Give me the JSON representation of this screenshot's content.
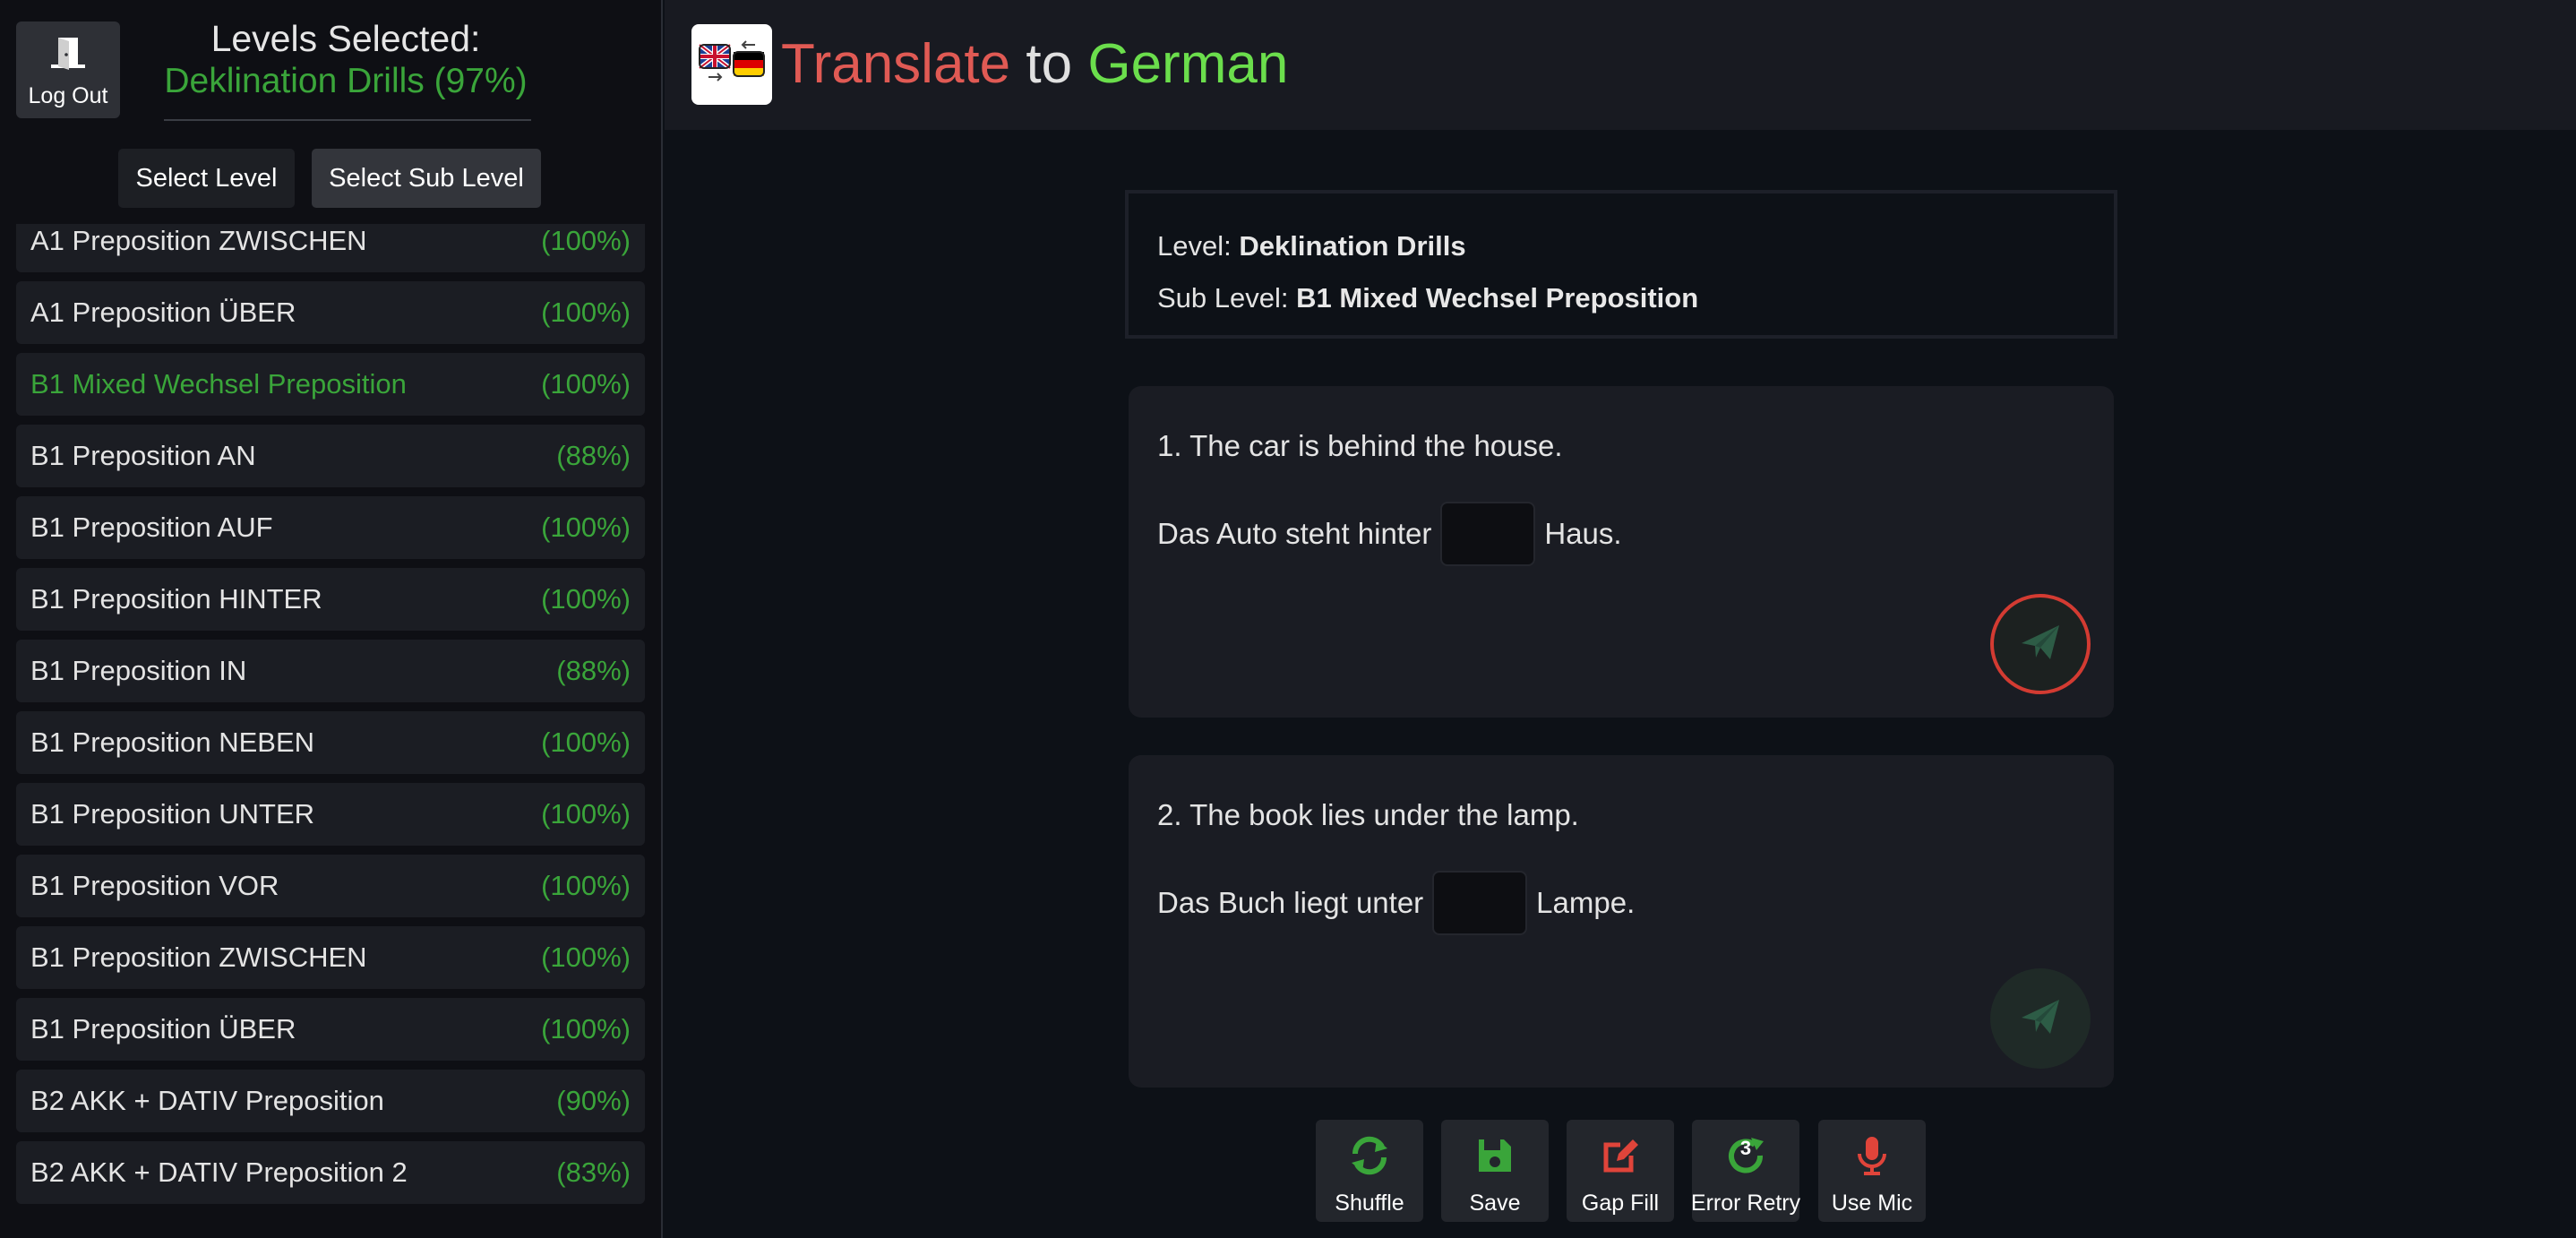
{
  "sidebar": {
    "logout_label": "Log Out",
    "levels_title": "Levels Selected:",
    "levels_value": "Deklination Drills (97%)",
    "select_level_label": "Select Level",
    "select_sub_level_label": "Select Sub Level",
    "items": [
      {
        "label": "A1 Preposition ZWISCHEN",
        "pct": "(100%)",
        "active": false
      },
      {
        "label": "A1 Preposition ÜBER",
        "pct": "(100%)",
        "active": false
      },
      {
        "label": "B1 Mixed Wechsel Preposition",
        "pct": "(100%)",
        "active": true
      },
      {
        "label": "B1 Preposition AN",
        "pct": "(88%)",
        "active": false
      },
      {
        "label": "B1 Preposition AUF",
        "pct": "(100%)",
        "active": false
      },
      {
        "label": "B1 Preposition HINTER",
        "pct": "(100%)",
        "active": false
      },
      {
        "label": "B1 Preposition IN",
        "pct": "(88%)",
        "active": false
      },
      {
        "label": "B1 Preposition NEBEN",
        "pct": "(100%)",
        "active": false
      },
      {
        "label": "B1 Preposition UNTER",
        "pct": "(100%)",
        "active": false
      },
      {
        "label": "B1 Preposition VOR",
        "pct": "(100%)",
        "active": false
      },
      {
        "label": "B1 Preposition ZWISCHEN",
        "pct": "(100%)",
        "active": false
      },
      {
        "label": "B1 Preposition ÜBER",
        "pct": "(100%)",
        "active": false
      },
      {
        "label": "B2 AKK + DATIV Preposition",
        "pct": "(90%)",
        "active": false
      },
      {
        "label": "B2 AKK + DATIV Preposition 2",
        "pct": "(83%)",
        "active": false
      }
    ]
  },
  "header": {
    "title_part1": "Translate",
    "title_part2": "to",
    "title_part3": "German",
    "logo_icon": "uk-germany-flags-icon"
  },
  "info": {
    "level_label": "Level:",
    "level_value": "Deklination Drills",
    "sub_level_label": "Sub Level:",
    "sub_level_value": "B1 Mixed Wechsel Preposition"
  },
  "questions": [
    {
      "prompt": "1. The car is behind the house.",
      "before": "Das Auto steht hinter",
      "answer": "",
      "after": "Haus."
    },
    {
      "prompt": "2. The book lies under the lamp.",
      "before": "Das Buch liegt unter",
      "answer": "",
      "after": "Lampe."
    }
  ],
  "toolbar": {
    "shuffle_label": "Shuffle",
    "save_label": "Save",
    "gap_fill_label": "Gap Fill",
    "error_retry_label": "Error Retry",
    "error_retry_count": "3",
    "use_mic_label": "Use Mic"
  },
  "colors": {
    "accent_green": "#3aa53a",
    "title_red": "#e05a54",
    "title_green": "#6bde4c",
    "ring_red": "#d33b32"
  }
}
